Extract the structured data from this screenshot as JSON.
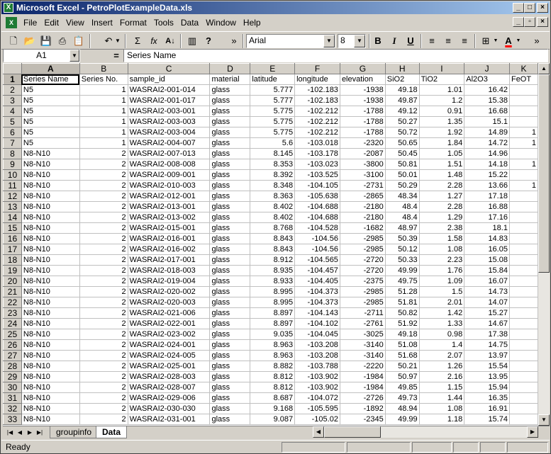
{
  "window": {
    "title": "Microsoft Excel - PetroPlotExampleData.xls",
    "app_icon": "excel-icon"
  },
  "menubar": {
    "items": [
      "File",
      "Edit",
      "View",
      "Insert",
      "Format",
      "Tools",
      "Data",
      "Window",
      "Help"
    ]
  },
  "toolbar": {
    "font_name": "Arial",
    "font_size": "8",
    "bold_label": "B",
    "italic_label": "I",
    "underline_label": "U",
    "sigma_label": "Σ",
    "fx_label": "fx",
    "az_label": "A↓",
    "overflow_label": "»",
    "help_label": "?"
  },
  "formula_bar": {
    "name_box": "A1",
    "equals": "=",
    "content": "Series Name"
  },
  "sheet": {
    "columns": [
      "A",
      "B",
      "C",
      "D",
      "E",
      "F",
      "G",
      "H",
      "I",
      "J",
      "K"
    ],
    "selected_column": "A",
    "selected_row": 1,
    "header_row": [
      "Series Name",
      "Series No.",
      "sample_id",
      "material",
      "latitude",
      "longitude",
      "elevation",
      "SiO2",
      "TiO2",
      "Al2O3",
      "FeOT"
    ],
    "rows": [
      [
        "N5",
        "1",
        "WASRAI2-001-014",
        "glass",
        "5.777",
        "-102.183",
        "-1938",
        "49.18",
        "1.01",
        "16.42",
        ""
      ],
      [
        "N5",
        "1",
        "WASRAI2-001-017",
        "glass",
        "5.777",
        "-102.183",
        "-1938",
        "49.87",
        "1.2",
        "15.38",
        ""
      ],
      [
        "N5",
        "1",
        "WASRAI2-003-001",
        "glass",
        "5.775",
        "-102.212",
        "-1788",
        "49.12",
        "0.91",
        "16.68",
        ""
      ],
      [
        "N5",
        "1",
        "WASRAI2-003-003",
        "glass",
        "5.775",
        "-102.212",
        "-1788",
        "50.27",
        "1.35",
        "15.1",
        ""
      ],
      [
        "N5",
        "1",
        "WASRAI2-003-004",
        "glass",
        "5.775",
        "-102.212",
        "-1788",
        "50.72",
        "1.92",
        "14.89",
        "1"
      ],
      [
        "N5",
        "1",
        "WASRAI2-004-007",
        "glass",
        "5.6",
        "-103.018",
        "-2320",
        "50.65",
        "1.84",
        "14.72",
        "1"
      ],
      [
        "N8-N10",
        "2",
        "WASRAI2-007-013",
        "glass",
        "8.145",
        "-103.178",
        "-2087",
        "50.45",
        "1.05",
        "14.96",
        ""
      ],
      [
        "N8-N10",
        "2",
        "WASRAI2-008-008",
        "glass",
        "8.353",
        "-103.023",
        "-3800",
        "50.81",
        "1.51",
        "14.18",
        "1"
      ],
      [
        "N8-N10",
        "2",
        "WASRAI2-009-001",
        "glass",
        "8.392",
        "-103.525",
        "-3100",
        "50.01",
        "1.48",
        "15.22",
        ""
      ],
      [
        "N8-N10",
        "2",
        "WASRAI2-010-003",
        "glass",
        "8.348",
        "-104.105",
        "-2731",
        "50.29",
        "2.28",
        "13.66",
        "1"
      ],
      [
        "N8-N10",
        "2",
        "WASRAI2-012-001",
        "glass",
        "8.363",
        "-105.638",
        "-2865",
        "48.34",
        "1.27",
        "17.18",
        ""
      ],
      [
        "N8-N10",
        "2",
        "WASRAI2-013-001",
        "glass",
        "8.402",
        "-104.688",
        "-2180",
        "48.4",
        "2.28",
        "16.88",
        ""
      ],
      [
        "N8-N10",
        "2",
        "WASRAI2-013-002",
        "glass",
        "8.402",
        "-104.688",
        "-2180",
        "48.4",
        "1.29",
        "17.16",
        ""
      ],
      [
        "N8-N10",
        "2",
        "WASRAI2-015-001",
        "glass",
        "8.768",
        "-104.528",
        "-1682",
        "48.97",
        "2.38",
        "18.1",
        ""
      ],
      [
        "N8-N10",
        "2",
        "WASRAI2-016-001",
        "glass",
        "8.843",
        "-104.56",
        "-2985",
        "50.39",
        "1.58",
        "14.83",
        ""
      ],
      [
        "N8-N10",
        "2",
        "WASRAI2-016-002",
        "glass",
        "8.843",
        "-104.56",
        "-2985",
        "50.12",
        "1.08",
        "16.05",
        ""
      ],
      [
        "N8-N10",
        "2",
        "WASRAI2-017-001",
        "glass",
        "8.912",
        "-104.565",
        "-2720",
        "50.33",
        "2.23",
        "15.08",
        ""
      ],
      [
        "N8-N10",
        "2",
        "WASRAI2-018-003",
        "glass",
        "8.935",
        "-104.457",
        "-2720",
        "49.99",
        "1.76",
        "15.84",
        ""
      ],
      [
        "N8-N10",
        "2",
        "WASRAI2-019-004",
        "glass",
        "8.933",
        "-104.405",
        "-2375",
        "49.75",
        "1.09",
        "16.07",
        ""
      ],
      [
        "N8-N10",
        "2",
        "WASRAI2-020-002",
        "glass",
        "8.995",
        "-104.373",
        "-2985",
        "51.28",
        "1.5",
        "14.73",
        ""
      ],
      [
        "N8-N10",
        "2",
        "WASRAI2-020-003",
        "glass",
        "8.995",
        "-104.373",
        "-2985",
        "51.81",
        "2.01",
        "14.07",
        ""
      ],
      [
        "N8-N10",
        "2",
        "WASRAI2-021-006",
        "glass",
        "8.897",
        "-104.143",
        "-2711",
        "50.82",
        "1.42",
        "15.27",
        ""
      ],
      [
        "N8-N10",
        "2",
        "WASRAI2-022-001",
        "glass",
        "8.897",
        "-104.102",
        "-2761",
        "51.92",
        "1.33",
        "14.67",
        ""
      ],
      [
        "N8-N10",
        "2",
        "WASRAI2-023-002",
        "glass",
        "9.035",
        "-104.045",
        "-3025",
        "49.18",
        "0.98",
        "17.38",
        ""
      ],
      [
        "N8-N10",
        "2",
        "WASRAI2-024-001",
        "glass",
        "8.963",
        "-103.208",
        "-3140",
        "51.08",
        "1.4",
        "14.75",
        ""
      ],
      [
        "N8-N10",
        "2",
        "WASRAI2-024-005",
        "glass",
        "8.963",
        "-103.208",
        "-3140",
        "51.68",
        "2.07",
        "13.97",
        ""
      ],
      [
        "N8-N10",
        "2",
        "WASRAI2-025-001",
        "glass",
        "8.882",
        "-103.788",
        "-2220",
        "50.21",
        "1.26",
        "15.54",
        ""
      ],
      [
        "N8-N10",
        "2",
        "WASRAI2-028-003",
        "glass",
        "8.812",
        "-103.902",
        "-1984",
        "50.97",
        "2.16",
        "13.95",
        ""
      ],
      [
        "N8-N10",
        "2",
        "WASRAI2-028-007",
        "glass",
        "8.812",
        "-103.902",
        "-1984",
        "49.85",
        "1.15",
        "15.94",
        ""
      ],
      [
        "N8-N10",
        "2",
        "WASRAI2-029-006",
        "glass",
        "8.687",
        "-104.072",
        "-2726",
        "49.73",
        "1.44",
        "16.35",
        ""
      ],
      [
        "N8-N10",
        "2",
        "WASRAI2-030-030",
        "glass",
        "9.168",
        "-105.595",
        "-1892",
        "48.94",
        "1.08",
        "16.91",
        ""
      ],
      [
        "N8-N10",
        "2",
        "WASRAI2-031-001",
        "glass",
        "9.087",
        "-105.02",
        "-2345",
        "49.99",
        "1.18",
        "15.74",
        ""
      ]
    ]
  },
  "tabs": {
    "items": [
      "groupinfo",
      "Data"
    ],
    "active": "Data"
  },
  "status": {
    "text": "Ready"
  }
}
